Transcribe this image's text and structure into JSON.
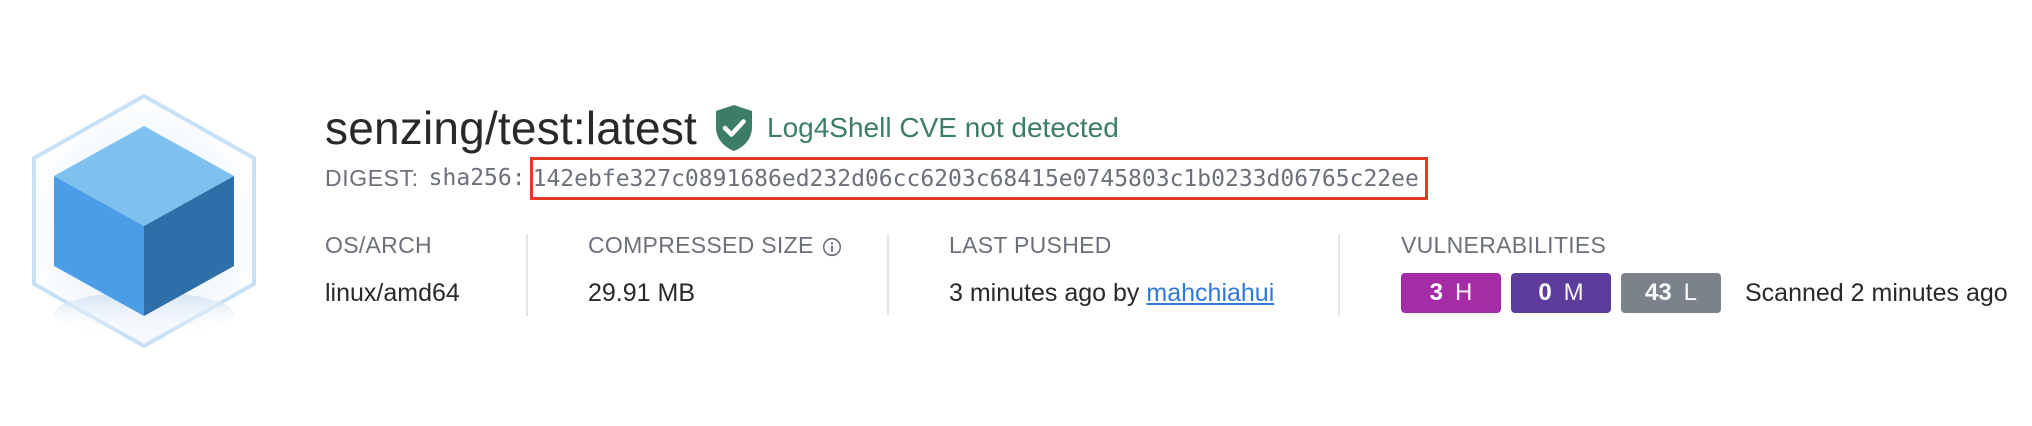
{
  "image": {
    "icon": "blue-cube-icon"
  },
  "header": {
    "title": "senzing/test:latest",
    "log4shell_icon": "shield-check-icon",
    "log4shell_text": "Log4Shell CVE not detected",
    "log4shell_color": "#3d7d68"
  },
  "digest": {
    "label": "DIGEST:",
    "algorithm": "sha256:",
    "hash": "142ebfe327c0891686ed232d06cc6203c68415e0745803c1b0233d06765c22ee",
    "highlight_color": "#e03a27"
  },
  "details": {
    "os_arch": {
      "label": "OS/ARCH",
      "value": "linux/amd64"
    },
    "compressed_size": {
      "label": "COMPRESSED SIZE",
      "icon": "info-icon",
      "value": "29.91 MB"
    },
    "last_pushed": {
      "label": "LAST PUSHED",
      "value": "3 minutes ago by",
      "author": "mahchiahui"
    },
    "vulnerabilities": {
      "label": "VULNERABILITIES",
      "badges": [
        {
          "count": "3",
          "severity": "H",
          "color": "#a52ca6"
        },
        {
          "count": "0",
          "severity": "M",
          "color": "#5d3d9c"
        },
        {
          "count": "43",
          "severity": "L",
          "color": "#7b828c"
        }
      ],
      "scanned": "Scanned 2 minutes ago"
    }
  }
}
